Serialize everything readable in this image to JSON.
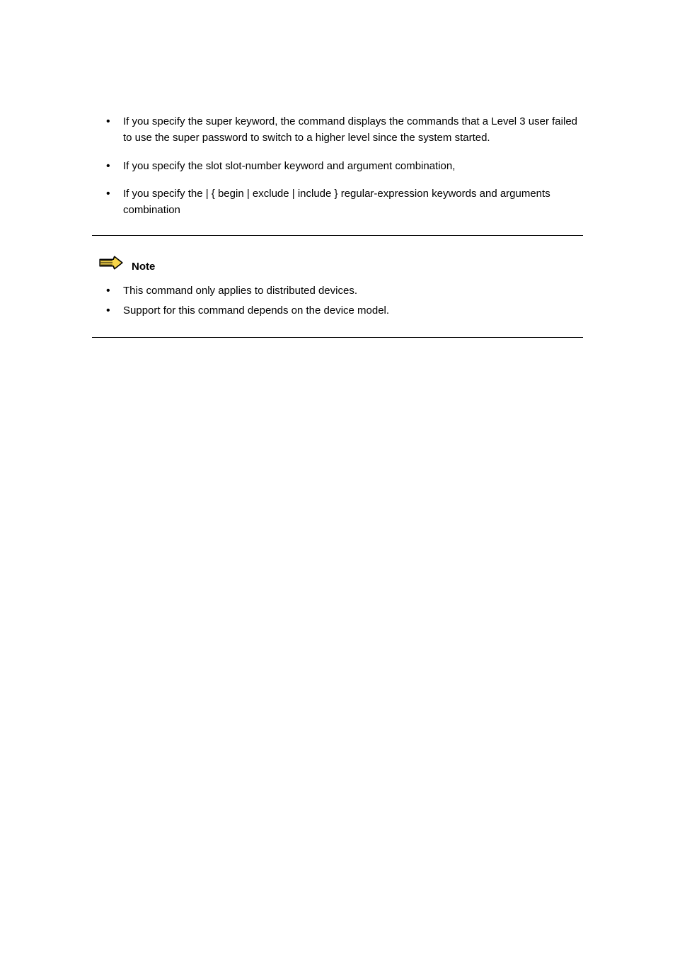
{
  "bullets": [
    "If you specify the super keyword, the command displays the commands that a Level 3 user failed to use the super password to switch to a higher level since the system started.",
    "If you specify the slot slot-number keyword and argument combination,",
    "If you specify the | { begin | exclude | include } regular-expression keywords and arguments combination"
  ],
  "note": {
    "label": "Note",
    "items": [
      "This command only applies to distributed devices.",
      "Support for this command depends on the device model."
    ]
  }
}
